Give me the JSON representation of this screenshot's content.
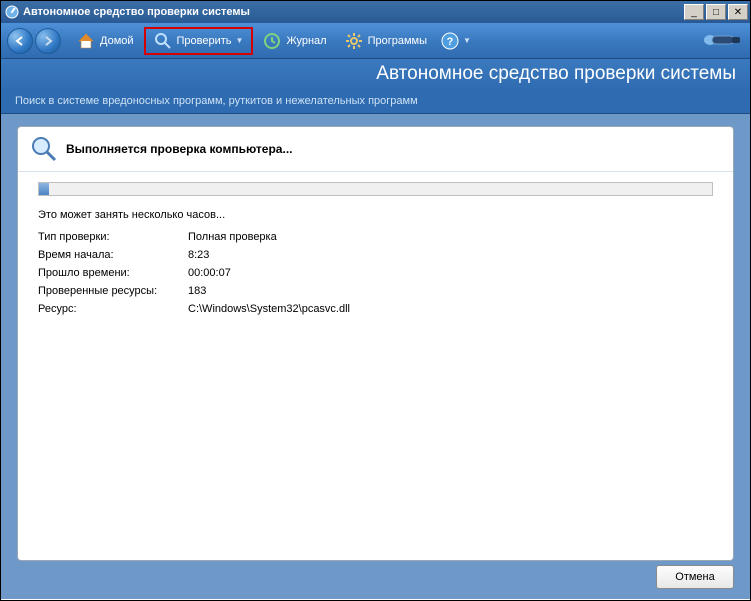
{
  "window": {
    "title": "Автономное средство проверки системы"
  },
  "toolbar": {
    "home": "Домой",
    "scan": "Проверить",
    "log": "Журнал",
    "programs": "Программы"
  },
  "app": {
    "title": "Автономное средство проверки системы",
    "desc": "Поиск в системе вредоносных программ, руткитов и нежелательных программ"
  },
  "scan": {
    "heading": "Выполняется проверка компьютера...",
    "note": "Это может занять несколько часов...",
    "rows": {
      "type_label": "Тип проверки:",
      "type_value": "Полная проверка",
      "start_label": "Время начала:",
      "start_value": "8:23",
      "elapsed_label": "Прошло времени:",
      "elapsed_value": "00:00:07",
      "scanned_label": "Проверенные ресурсы:",
      "scanned_value": "183",
      "resource_label": "Ресурс:",
      "resource_value": "C:\\Windows\\System32\\pcasvc.dll"
    }
  },
  "buttons": {
    "cancel": "Отмена"
  }
}
